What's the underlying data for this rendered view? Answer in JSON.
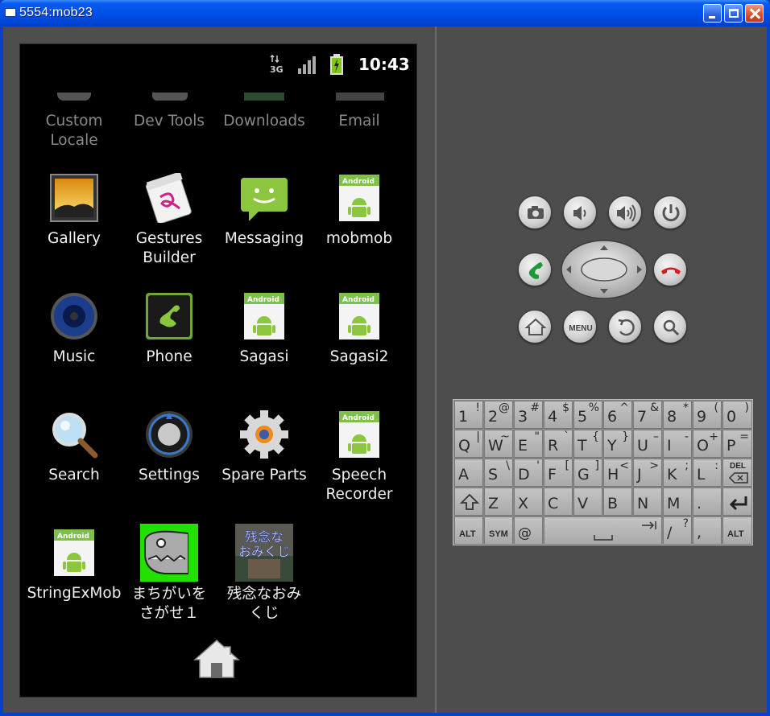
{
  "window": {
    "title": "5554:mob23"
  },
  "statusbar": {
    "time": "10:43",
    "network_label": "3G"
  },
  "apps_row0": [
    {
      "label_line1": "Custom",
      "label_line2": "Locale"
    },
    {
      "label_line1": "Dev Tools",
      "label_line2": ""
    },
    {
      "label_line1": "Downloads",
      "label_line2": ""
    },
    {
      "label_line1": "Email",
      "label_line2": ""
    }
  ],
  "apps": [
    {
      "label_line1": "Gallery",
      "label_line2": "",
      "icon": "gallery-icon"
    },
    {
      "label_line1": "Gestures",
      "label_line2": "Builder",
      "icon": "gestures-icon"
    },
    {
      "label_line1": "Messaging",
      "label_line2": "",
      "icon": "messaging-icon"
    },
    {
      "label_line1": "mobmob",
      "label_line2": "",
      "icon": "android-app-icon"
    },
    {
      "label_line1": "Music",
      "label_line2": "",
      "icon": "music-icon"
    },
    {
      "label_line1": "Phone",
      "label_line2": "",
      "icon": "phone-icon"
    },
    {
      "label_line1": "Sagasi",
      "label_line2": "",
      "icon": "android-app-icon"
    },
    {
      "label_line1": "Sagasi2",
      "label_line2": "",
      "icon": "android-app-icon"
    },
    {
      "label_line1": "Search",
      "label_line2": "",
      "icon": "search-icon"
    },
    {
      "label_line1": "Settings",
      "label_line2": "",
      "icon": "settings-icon"
    },
    {
      "label_line1": "Spare Parts",
      "label_line2": "",
      "icon": "spare-parts-icon"
    },
    {
      "label_line1": "Speech",
      "label_line2": "Recorder",
      "icon": "android-app-icon"
    },
    {
      "label_line1": "StringExMob",
      "label_line2": "",
      "icon": "android-app-icon"
    },
    {
      "label_line1": "まちがいを",
      "label_line2": "さがせ１",
      "icon": "machigai-icon"
    },
    {
      "label_line1": "残念なおみ",
      "label_line2": "くじ",
      "icon": "omikuji-icon"
    }
  ],
  "android_badge": "Android",
  "omikuji_icon_text": [
    "残念な",
    "おみくじ"
  ],
  "keyboard": {
    "row1": [
      [
        "1",
        "!"
      ],
      [
        "2",
        "@"
      ],
      [
        "3",
        "#"
      ],
      [
        "4",
        "$"
      ],
      [
        "5",
        "%"
      ],
      [
        "6",
        "^"
      ],
      [
        "7",
        "&"
      ],
      [
        "8",
        "*"
      ],
      [
        "9",
        "("
      ],
      [
        "0",
        ")"
      ]
    ],
    "row2": [
      [
        "Q",
        "|"
      ],
      [
        "W",
        "~"
      ],
      [
        "E",
        "\""
      ],
      [
        "R",
        "`"
      ],
      [
        "T",
        "{"
      ],
      [
        "Y",
        "}"
      ],
      [
        "U",
        "–"
      ],
      [
        "I",
        "-"
      ],
      [
        "O",
        "+"
      ],
      [
        "P",
        "="
      ]
    ],
    "row3": [
      [
        "A",
        ""
      ],
      [
        "S",
        "\\"
      ],
      [
        "D",
        "'"
      ],
      [
        "F",
        "["
      ],
      [
        "G",
        "]"
      ],
      [
        "H",
        "<"
      ],
      [
        "J",
        ">"
      ],
      [
        "K",
        ";"
      ],
      [
        "L",
        ":"
      ]
    ],
    "row4": [
      [
        "Z",
        ""
      ],
      [
        "X",
        ""
      ],
      [
        "C",
        ""
      ],
      [
        "V",
        ""
      ],
      [
        "B",
        ""
      ],
      [
        "N",
        ""
      ],
      [
        "M",
        ""
      ],
      [
        ".",
        ""
      ]
    ],
    "row5": [
      [
        "/",
        "?"
      ],
      [
        ",",
        ""
      ]
    ],
    "del_label": "DEL",
    "alt_label": "ALT",
    "sym_label": "SYM",
    "at_label": "@",
    "menu_label": "MENU"
  },
  "colors": {
    "titlebar": "#0054e3",
    "screen_bg": "#000000",
    "emulator_bg": "#4d4d4d",
    "call_green": "#1a9a3a",
    "endcall_red": "#d02020"
  }
}
